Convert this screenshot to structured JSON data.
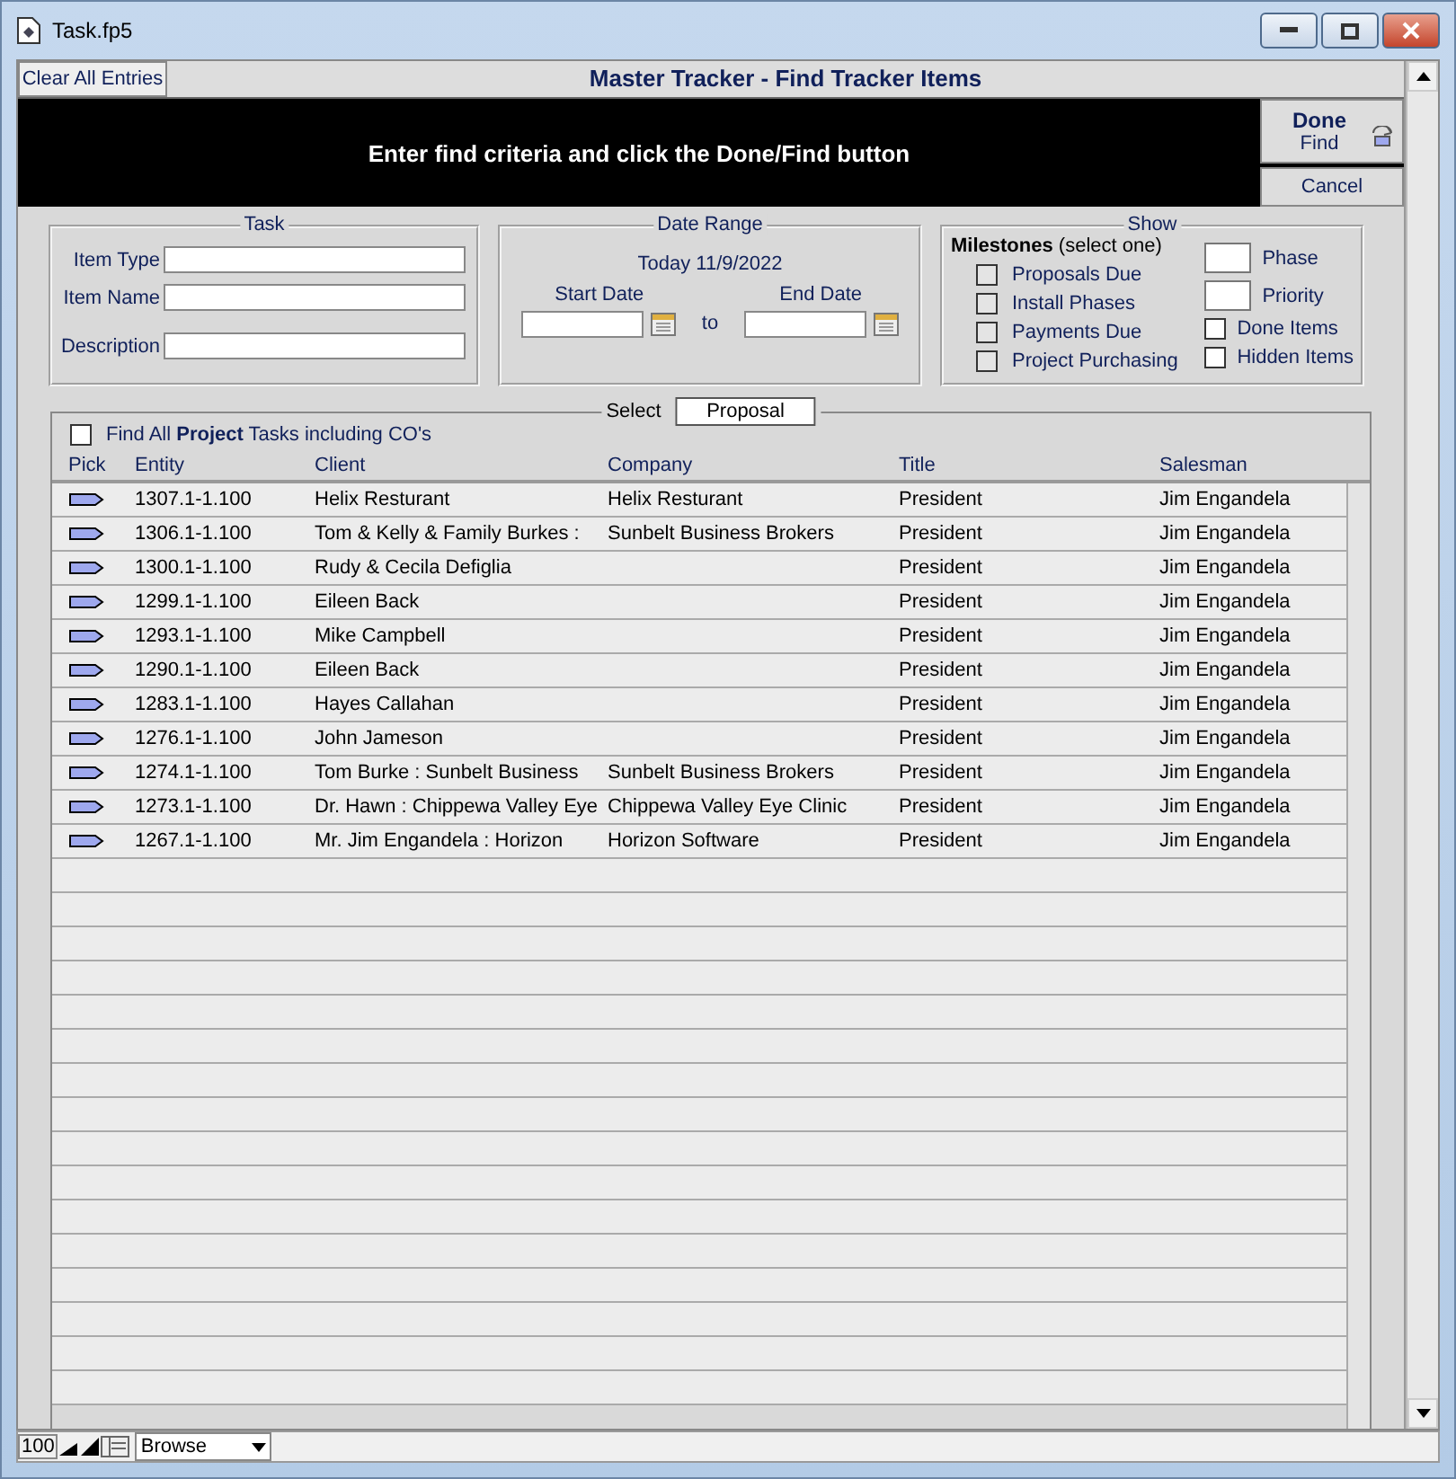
{
  "window": {
    "title": "Task.fp5"
  },
  "header": {
    "clear_button": "Clear All Entries",
    "title": "Master Tracker - Find Tracker Items",
    "banner": "Enter find criteria and click the Done/Find button",
    "done_button": {
      "label": "Done",
      "sublabel": "Find"
    },
    "cancel_button": "Cancel"
  },
  "task": {
    "title": "Task",
    "fields": [
      {
        "label": "Item Type"
      },
      {
        "label": "Item Name"
      },
      {
        "label": "Description"
      }
    ]
  },
  "date_range": {
    "title": "Date Range",
    "today": "Today 11/9/2022",
    "start_label": "Start Date",
    "end_label": "End Date",
    "separator": "to"
  },
  "show": {
    "title": "Show",
    "milestones_heading": "**Milestones** (select one)",
    "milestones": [
      {
        "label": "Proposals Due",
        "checked": false
      },
      {
        "label": "Install Phases",
        "checked": false
      },
      {
        "label": "Payments Due",
        "checked": false
      },
      {
        "label": "Project Purchasing",
        "checked": false
      }
    ],
    "fields": [
      {
        "label": "Phase"
      },
      {
        "label": "Priority"
      }
    ],
    "options": [
      {
        "label": "Done Items",
        "checked": false
      },
      {
        "label": "Hidden Items",
        "checked": false
      }
    ]
  },
  "select": {
    "title": "Select",
    "tab": "Proposal",
    "find_all": {
      "label": "Find All **Project** Tasks including CO's",
      "checked": false
    }
  },
  "table": {
    "columns": [
      "Pick",
      "Entity",
      "Client",
      "Company",
      "Title",
      "Salesman"
    ],
    "rows": [
      [
        "",
        "1307.1-1.100",
        "Helix Resturant",
        "Helix Resturant",
        "President",
        "Jim Engandela"
      ],
      [
        "",
        "1306.1-1.100",
        "Tom & Kelly & Family Burkes :",
        "Sunbelt Business Brokers",
        "President",
        "Jim Engandela"
      ],
      [
        "",
        "1300.1-1.100",
        "Rudy & Cecila Defiglia",
        "",
        "President",
        "Jim Engandela"
      ],
      [
        "",
        "1299.1-1.100",
        "Eileen Back",
        "",
        "President",
        "Jim Engandela"
      ],
      [
        "",
        "1293.1-1.100",
        "Mike Campbell",
        "",
        "President",
        "Jim Engandela"
      ],
      [
        "",
        "1290.1-1.100",
        "Eileen Back",
        "",
        "President",
        "Jim Engandela"
      ],
      [
        "",
        "1283.1-1.100",
        "Hayes Callahan",
        "",
        "President",
        "Jim Engandela"
      ],
      [
        "",
        "1276.1-1.100",
        "John Jameson",
        "",
        "President",
        "Jim Engandela"
      ],
      [
        "",
        "1274.1-1.100",
        "Tom Burke : Sunbelt Business",
        "Sunbelt Business Brokers",
        "President",
        "Jim Engandela"
      ],
      [
        "",
        "1273.1-1.100",
        "Dr. Hawn : Chippewa Valley Eye",
        "Chippewa Valley Eye Clinic",
        "President",
        "Jim Engandela"
      ],
      [
        "",
        "1267.1-1.100",
        "Mr. Jim Engandela : Horizon",
        "Horizon Software",
        "President",
        "Jim Engandela"
      ]
    ]
  },
  "status_bar": {
    "zoom": "100",
    "mode": "Browse"
  }
}
